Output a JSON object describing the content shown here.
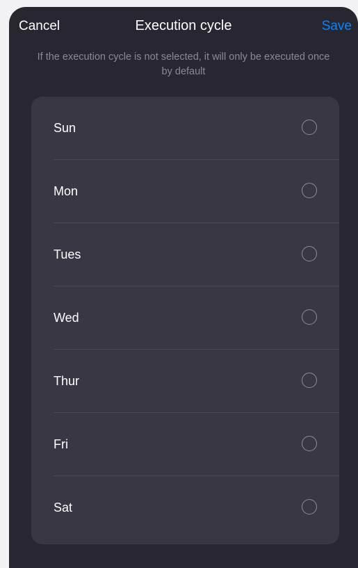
{
  "header": {
    "cancel_label": "Cancel",
    "title": "Execution cycle",
    "save_label": "Save"
  },
  "hint": "If the execution cycle is not selected, it will only be executed once by default",
  "days": [
    {
      "label": "Sun",
      "selected": false
    },
    {
      "label": "Mon",
      "selected": false
    },
    {
      "label": "Tues",
      "selected": false
    },
    {
      "label": "Wed",
      "selected": false
    },
    {
      "label": "Thur",
      "selected": false
    },
    {
      "label": "Fri",
      "selected": false
    },
    {
      "label": "Sat",
      "selected": false
    }
  ],
  "colors": {
    "sheet_bg": "#282731",
    "list_bg": "#383743",
    "accent": "#0a84ff",
    "hint_text": "#8b8a94"
  }
}
